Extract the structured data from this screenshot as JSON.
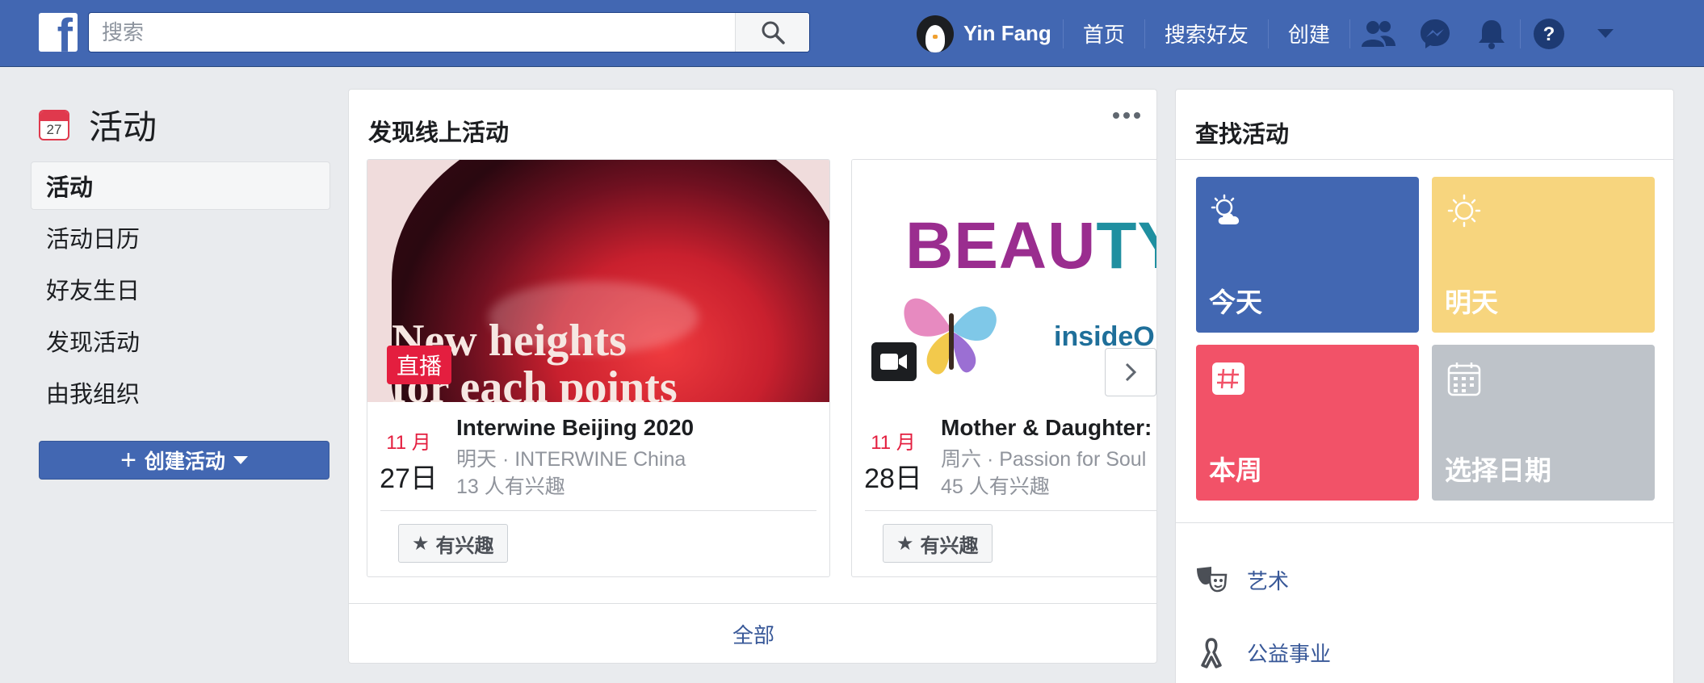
{
  "topbar": {
    "search_placeholder": "搜索",
    "user_name": "Yin Fang",
    "links": [
      "首页",
      "搜索好友",
      "创建"
    ]
  },
  "sidebar": {
    "calendar_day": "27",
    "title": "活动",
    "items": [
      {
        "label": "活动",
        "active": true
      },
      {
        "label": "活动日历",
        "active": false
      },
      {
        "label": "好友生日",
        "active": false
      },
      {
        "label": "发现活动",
        "active": false
      },
      {
        "label": "由我组织",
        "active": false
      }
    ],
    "create_button": "创建活动"
  },
  "discover": {
    "title": "发现线上活动",
    "events": [
      {
        "image_headline_line1": "New heights",
        "image_headline_line2": "for each points",
        "badge": "直播",
        "month": "11 月",
        "day": "27日",
        "title": "Interwine Beijing 2020",
        "meta": "明天 · INTERWINE China",
        "interested": "13 人有兴趣",
        "button": "有兴趣"
      },
      {
        "image_word": "BEAUTY",
        "image_subword": "insideO",
        "month": "11 月",
        "day": "28日",
        "title": "Mother & Daughter: Beauty Inside Out",
        "meta": "周六 · Passion for Soul",
        "interested": "45 人有兴趣",
        "button": "有兴趣"
      }
    ],
    "see_all": "全部"
  },
  "find": {
    "title": "查找活动",
    "tiles": [
      {
        "label": "今天",
        "color": "#4267b2",
        "icon": "partly-cloudy-icon"
      },
      {
        "label": "明天",
        "color": "#f7d57e",
        "icon": "sun-icon"
      },
      {
        "label": "本周",
        "color": "#f25268",
        "icon": "hashtag-calendar-icon"
      },
      {
        "label": "选择日期",
        "color": "#bec3c9",
        "icon": "calendar-grid-icon"
      }
    ],
    "categories": [
      {
        "label": "艺术",
        "icon": "theater-masks-icon"
      },
      {
        "label": "公益事业",
        "icon": "ribbon-icon"
      }
    ]
  },
  "colors": {
    "brand": "#4267b2",
    "link": "#385898",
    "date_red": "#e41e3f",
    "page_bg": "#e9ebee"
  }
}
